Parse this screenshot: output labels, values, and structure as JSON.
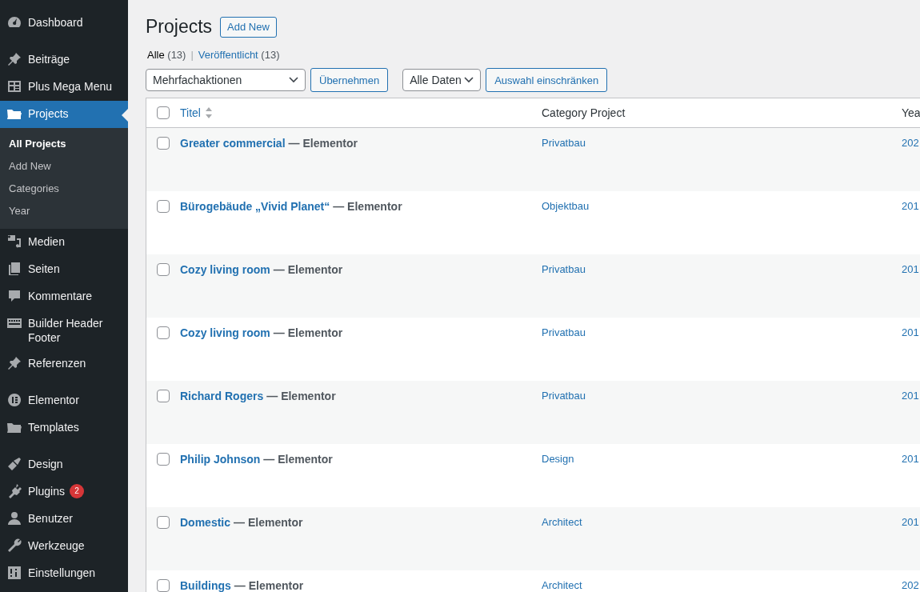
{
  "sidebar": {
    "groups": [
      [
        {
          "label": "Dashboard",
          "selected": false
        }
      ],
      [
        {
          "label": "Beiträge",
          "selected": false
        },
        {
          "label": "Plus Mega Menu",
          "selected": false
        },
        {
          "label": "Projects",
          "selected": true,
          "children": [
            {
              "label": "All Projects",
              "selected": true
            },
            {
              "label": "Add New",
              "selected": false
            },
            {
              "label": "Categories",
              "selected": false
            },
            {
              "label": "Year",
              "selected": false
            }
          ]
        },
        {
          "label": "Medien",
          "selected": false
        },
        {
          "label": "Seiten",
          "selected": false
        },
        {
          "label": "Kommentare",
          "selected": false
        },
        {
          "label": "Builder Header Footer",
          "selected": false
        },
        {
          "label": "Referenzen",
          "selected": false
        }
      ],
      [
        {
          "label": "Elementor",
          "selected": false
        },
        {
          "label": "Templates",
          "selected": false
        }
      ],
      [
        {
          "label": "Design",
          "selected": false
        },
        {
          "label": "Plugins",
          "selected": false,
          "badge": "2"
        },
        {
          "label": "Benutzer",
          "selected": false
        },
        {
          "label": "Werkzeuge",
          "selected": false
        },
        {
          "label": "Einstellungen",
          "selected": false
        }
      ]
    ]
  },
  "page": {
    "title": "Projects",
    "add_button": "Add New"
  },
  "views": {
    "separator": "|",
    "items": [
      {
        "label": "Alle",
        "count": "(13)",
        "selected": true
      },
      {
        "label": "Veröffentlicht",
        "count": "(13)",
        "selected": false
      }
    ]
  },
  "toolbar": {
    "bulk_select": "Mehrfachaktionen",
    "apply_button": "Übernehmen",
    "date_select": "Alle Daten",
    "filter_button": "Auswahl einschränken"
  },
  "table": {
    "select_all": {
      "checked": false
    },
    "columns": [
      "Titel",
      "Category Project",
      "Yea"
    ],
    "rows": [
      {
        "checked": false,
        "title": "Greater commercial",
        "suffix": "— Elementor",
        "category": "Privatbau",
        "year": "202"
      },
      {
        "checked": false,
        "title": "Bürogebäude „Vivid Planet“",
        "suffix": "— Elementor",
        "category": "Objektbau",
        "year": "201"
      },
      {
        "checked": false,
        "title": "Cozy living room",
        "suffix": "— Elementor",
        "category": "Privatbau",
        "year": "201"
      },
      {
        "checked": false,
        "title": "Cozy living room",
        "suffix": "— Elementor",
        "category": "Privatbau",
        "year": "201"
      },
      {
        "checked": false,
        "title": "Richard Rogers",
        "suffix": "— Elementor",
        "category": "Privatbau",
        "year": "201"
      },
      {
        "checked": false,
        "title": "Philip Johnson",
        "suffix": "— Elementor",
        "category": "Design",
        "year": "201"
      },
      {
        "checked": false,
        "title": "Domestic",
        "suffix": "— Elementor",
        "category": "Architect",
        "year": "201"
      },
      {
        "checked": false,
        "title": "Buildings",
        "suffix": "— Elementor",
        "category": "Architect",
        "year": "202"
      }
    ]
  }
}
